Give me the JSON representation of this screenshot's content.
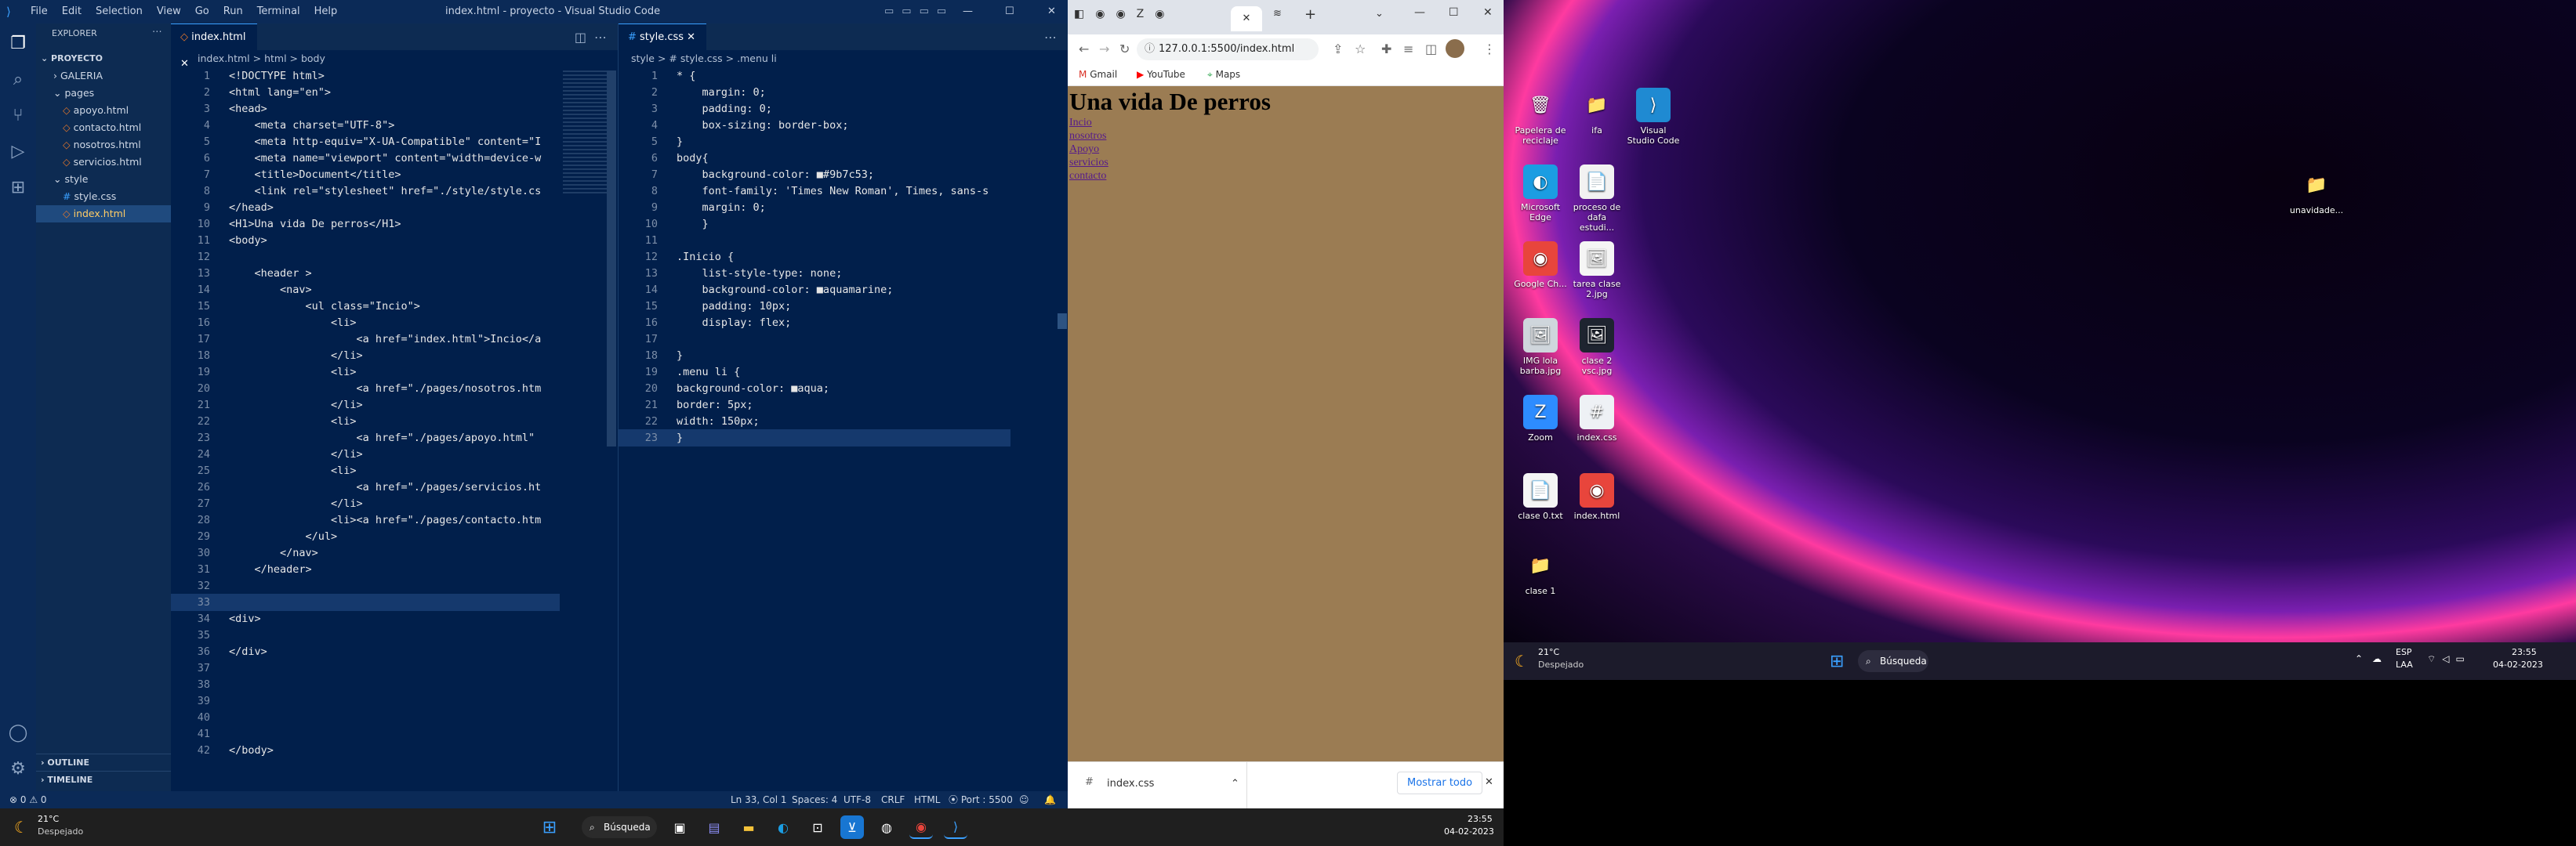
{
  "vscode": {
    "window_title": "index.html - proyecto - Visual Studio Code",
    "menu": [
      "File",
      "Edit",
      "Selection",
      "View",
      "Go",
      "Run",
      "Terminal",
      "Help"
    ],
    "explorer_label": "EXPLORER",
    "project": "PROYECTO",
    "tree": [
      {
        "label": "GALERIA",
        "indent": 1,
        "type": "folder"
      },
      {
        "label": "pages",
        "indent": 1,
        "type": "folder-open"
      },
      {
        "label": "apoyo.html",
        "indent": 2,
        "type": "html"
      },
      {
        "label": "contacto.html",
        "indent": 2,
        "type": "html"
      },
      {
        "label": "nosotros.html",
        "indent": 2,
        "type": "html"
      },
      {
        "label": "servicios.html",
        "indent": 2,
        "type": "html"
      },
      {
        "label": "style",
        "indent": 1,
        "type": "folder-open"
      },
      {
        "label": "style.css",
        "indent": 2,
        "type": "css"
      },
      {
        "label": "index.html",
        "indent": 2,
        "type": "html",
        "selected": true
      }
    ],
    "outline_label": "OUTLINE",
    "timeline_label": "TIMELINE",
    "left_tab": "index.html",
    "left_breadcrumb": "index.html  >  html  >  body",
    "right_tab": "style.css",
    "right_breadcrumb": "style  >  # style.css  >  .menu li",
    "html_lines": [
      "<!DOCTYPE html>",
      "<html lang=\"en\">",
      "<head>",
      "    <meta charset=\"UTF-8\">",
      "    <meta http-equiv=\"X-UA-Compatible\" content=\"I",
      "    <meta name=\"viewport\" content=\"width=device-w",
      "    <title>Document</title>",
      "    <link rel=\"stylesheet\" href=\"./style/style.cs",
      "</head>",
      "<H1>Una vida De perros</H1>",
      "<body>",
      "",
      "    <header >",
      "        <nav>",
      "            <ul class=\"Incio\">",
      "                <li>",
      "                    <a href=\"index.html\">Incio</a",
      "                </li>",
      "                <li>",
      "                    <a href=\"./pages/nosotros.htm",
      "                </li>",
      "                <li>",
      "                    <a href=\"./pages/apoyo.html\"",
      "                </li>",
      "                <li>",
      "                    <a href=\"./pages/servicios.ht",
      "                </li>",
      "                <li><a href=\"./pages/contacto.htm",
      "            </ul>",
      "        </nav>",
      "    </header>",
      "",
      "",
      "<div>",
      "",
      "</div>",
      "",
      "",
      "",
      "",
      "",
      "</body>"
    ],
    "css_lines": [
      "* {",
      "    margin: 0;",
      "    padding: 0;",
      "    box-sizing: border-box;",
      "}",
      "body{",
      "    background-color: ■#9b7c53;",
      "    font-family: 'Times New Roman', Times, sans-s",
      "    margin: 0;",
      "    }",
      "",
      ".Inicio {",
      "    list-style-type: none;",
      "    background-color: ■aquamarine;",
      "    padding: 10px;",
      "    display: flex;",
      "",
      "}",
      ".menu li {",
      "background-color: ■aqua;",
      "border: 5px;",
      "width: 150px;",
      "}"
    ],
    "status": {
      "left": "⊗ 0 ⚠ 0",
      "position": "Ln 33, Col 1",
      "spaces": "Spaces: 4",
      "encoding": "UTF-8",
      "eol": "CRLF",
      "language": "HTML",
      "port": "Port : 5500"
    }
  },
  "browser": {
    "url": "127.0.0.1:5500/index.html",
    "bookmarks": [
      "Gmail",
      "YouTube",
      "Maps"
    ],
    "page_title": "Una vida De perros",
    "links": [
      "Incio",
      "nosotros",
      "Apoyo",
      "servicios",
      "contacto"
    ],
    "download_file": "index.css",
    "show_all": "Mostrar todo",
    "bg_color": "#9b7c53"
  },
  "desktop": {
    "icons": [
      {
        "label": "Papelera de reciclaje",
        "icon": "recycle-bin-icon",
        "glyph": "🗑",
        "bg": "transparent"
      },
      {
        "label": "ifa",
        "icon": "folder-icon",
        "glyph": "📁",
        "bg": "transparent"
      },
      {
        "label": "Visual Studio Code",
        "icon": "vscode-icon",
        "glyph": "⟩",
        "bg": "#1f8ad2"
      },
      {
        "label": "Microsoft Edge",
        "icon": "edge-icon",
        "glyph": "◐",
        "bg": "#1b9de2"
      },
      {
        "label": "proceso de dafa estudi...",
        "icon": "pdf-icon",
        "glyph": "📄",
        "bg": "#f2f2f2"
      },
      {
        "label": "Google Ch...",
        "icon": "chrome-icon",
        "glyph": "◉",
        "bg": "#e8453c"
      },
      {
        "label": "tarea clase 2.jpg",
        "icon": "image-icon",
        "glyph": "🖼",
        "bg": "#f5f5f5"
      },
      {
        "label": "IMG lola barba.jpg",
        "icon": "image-icon",
        "glyph": "🖼",
        "bg": "#cfd6dc"
      },
      {
        "label": "clase 2 vsc.jpg",
        "icon": "image-icon",
        "glyph": "🖼",
        "bg": "#1e2430"
      },
      {
        "label": "Zoom",
        "icon": "zoom-icon",
        "glyph": "Z",
        "bg": "#2d8cff"
      },
      {
        "label": "index.css",
        "icon": "css-file-icon",
        "glyph": "#",
        "bg": "#eef1f5"
      },
      {
        "label": "clase 0.txt",
        "icon": "text-file-icon",
        "glyph": "📄",
        "bg": "#f5f5f5"
      },
      {
        "label": "index.html",
        "icon": "chrome-icon",
        "glyph": "◉",
        "bg": "#e8453c"
      },
      {
        "label": "clase 1",
        "icon": "folder-icon",
        "glyph": "📁",
        "bg": "transparent"
      },
      {
        "label": "unavidade...",
        "icon": "folder-icon",
        "glyph": "📁",
        "bg": "transparent"
      }
    ],
    "taskbar_weather_temp": "21°C",
    "taskbar_weather_text": "Despejado",
    "taskbar_search": "Búsqueda",
    "tray_lang": "ESP",
    "tray_layout": "LAA",
    "tray_time": "23:55",
    "tray_date": "04-02-2023"
  },
  "taskbar": {
    "weather_temp": "21°C",
    "weather_text": "Despejado",
    "search": "Búsqueda",
    "time": "23:55",
    "date": "04-02-2023"
  }
}
